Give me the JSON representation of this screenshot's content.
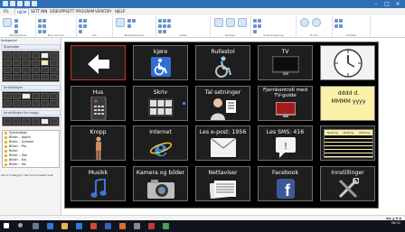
{
  "menubar": {
    "tabs": [
      "FIL",
      "HJEM",
      "SETT INN",
      "SIDEOPPSETT",
      "PROGRAM",
      "VERKTØY",
      "HJELP"
    ]
  },
  "ribbon": {
    "groups": [
      "Utklippstavle",
      "Nye vinduer",
      "Vis",
      "Meldingsvindu",
      "Celler",
      "Rediger",
      "Sidenavigering",
      "Zoom",
      "Ordliste"
    ]
  },
  "leftpanel": {
    "sidepanel_label": "Sidepanel",
    "start_label": "Startsider",
    "settings_label": "Innstillinger",
    "settings_for_label": "Innstillinger for mapp",
    "files": [
      "Symboltegn",
      "Bilder – Applik",
      "Bilder – Sykdom",
      "Bilder – Pro",
      "Bilder",
      "Bilder – Uke",
      "Bilder – Kro",
      "Bilder – Fat"
    ],
    "bottom_note": "Alt er innebygd i den fra innlastet side"
  },
  "board": {
    "cells": [
      {
        "label": ""
      },
      {
        "label": "kjøre"
      },
      {
        "label": "Rullestol"
      },
      {
        "label": "TV"
      },
      {
        "label": ""
      },
      {
        "label": "Hus"
      },
      {
        "label": "Skriv"
      },
      {
        "label": "Tal setninger"
      },
      {
        "label": "Fjernkontroll med TV-guide"
      },
      {
        "label": "dddd d. MMMM yyyy"
      },
      {
        "label": "Kropp"
      },
      {
        "label": "Internet"
      },
      {
        "label": "Les e-post: 1956"
      },
      {
        "label": "Les SMS: 416"
      },
      {
        "label": ""
      },
      {
        "label": "Musikk"
      },
      {
        "label": "Kamera og bilder"
      },
      {
        "label": "Nettaviser"
      },
      {
        "label": "Facebook"
      },
      {
        "label": "Innstillinger"
      }
    ],
    "calendar_header": [
      "Nothing",
      "Nothing",
      "Nothing"
    ]
  },
  "taskbar": {
    "time": "08:01"
  },
  "colors": {
    "titlebar": "#2f6fb6",
    "board_bg": "#000000",
    "cell_bg": "#1e1e1e",
    "accent_yellow": "#fbf0a8",
    "taskbar": "#10141c"
  }
}
